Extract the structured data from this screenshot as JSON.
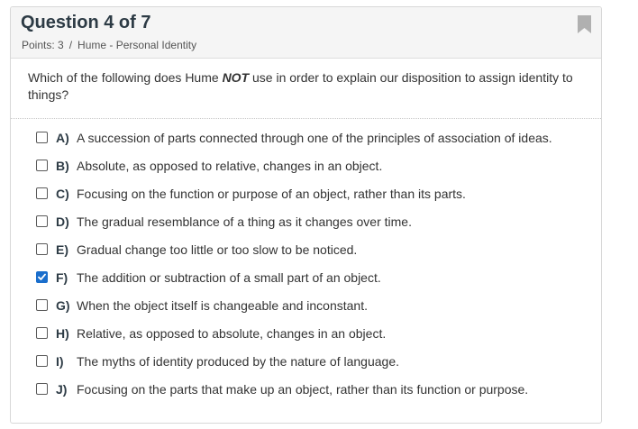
{
  "question": {
    "title": "Question 4 of 7",
    "points": "Points: 3",
    "separator": "/",
    "topic": "Hume - Personal Identity",
    "prompt_before": "Which of the following does Hume ",
    "prompt_emph": "NOT",
    "prompt_after": " use in order to explain our disposition to assign identity to things?"
  },
  "colors": {
    "checkbox_checked": "#1a6ecc",
    "header_bg": "#f5f5f5",
    "bookmark": "#b0b0b0"
  },
  "answers": [
    {
      "letter": "A)",
      "text": "A succession of parts connected through one of the principles of association of ideas.",
      "checked": false
    },
    {
      "letter": "B)",
      "text": "Absolute, as opposed to relative, changes in an object.",
      "checked": false
    },
    {
      "letter": "C)",
      "text": "Focusing on the function or purpose of an object, rather than its parts.",
      "checked": false
    },
    {
      "letter": "D)",
      "text": "The gradual resemblance of a thing as it changes over time.",
      "checked": false
    },
    {
      "letter": "E)",
      "text": "Gradual change too little or too slow to be noticed.",
      "checked": false
    },
    {
      "letter": "F)",
      "text": "The addition or subtraction of a small part of an object.",
      "checked": true
    },
    {
      "letter": "G)",
      "text": "When the object itself is changeable and inconstant.",
      "checked": false
    },
    {
      "letter": "H)",
      "text": "Relative, as opposed to absolute, changes in an object.",
      "checked": false
    },
    {
      "letter": "I)",
      "text": "The myths of identity produced by the nature of language.",
      "checked": false
    },
    {
      "letter": "J)",
      "text": "Focusing on the parts that make up an object, rather than its function or purpose.",
      "checked": false
    }
  ]
}
